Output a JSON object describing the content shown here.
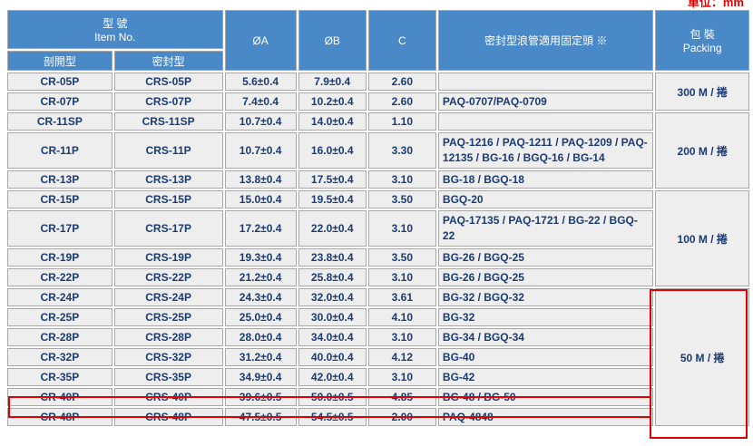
{
  "unit_label": "單位：mm",
  "header": {
    "item_no_zh": "型 號",
    "item_no_en": "Item No.",
    "col_a": "ØA",
    "col_b": "ØB",
    "col_c": "C",
    "fitting": "密封型浪管適用固定頭 ※",
    "packing_zh": "包 裝",
    "packing_en": "Packing",
    "split_type": "剖開型",
    "sealed_type": "密封型"
  },
  "rows": [
    {
      "split": "CR-05P",
      "sealed": "CRS-05P",
      "a": "5.6±0.4",
      "b": "7.9±0.4",
      "c": "2.60",
      "fitting": ""
    },
    {
      "split": "CR-07P",
      "sealed": "CRS-07P",
      "a": "7.4±0.4",
      "b": "10.2±0.4",
      "c": "2.60",
      "fitting": "PAQ-0707/PAQ-0709"
    },
    {
      "split": "CR-11SP",
      "sealed": "CRS-11SP",
      "a": "10.7±0.4",
      "b": "14.0±0.4",
      "c": "1.10",
      "fitting": ""
    },
    {
      "split": "CR-11P",
      "sealed": "CRS-11P",
      "a": "10.7±0.4",
      "b": "16.0±0.4",
      "c": "3.30",
      "fitting": "PAQ-1216 / PAQ-1211 / PAQ-1209 / PAQ-12135 / BG-16 / BGQ-16 / BG-14"
    },
    {
      "split": "CR-13P",
      "sealed": "CRS-13P",
      "a": "13.8±0.4",
      "b": "17.5±0.4",
      "c": "3.10",
      "fitting": "BG-18 / BGQ-18"
    },
    {
      "split": "CR-15P",
      "sealed": "CRS-15P",
      "a": "15.0±0.4",
      "b": "19.5±0.4",
      "c": "3.50",
      "fitting": "BGQ-20"
    },
    {
      "split": "CR-17P",
      "sealed": "CRS-17P",
      "a": "17.2±0.4",
      "b": "22.0±0.4",
      "c": "3.10",
      "fitting": "PAQ-17135 / PAQ-1721 / BG-22 / BGQ-22"
    },
    {
      "split": "CR-19P",
      "sealed": "CRS-19P",
      "a": "19.3±0.4",
      "b": "23.8±0.4",
      "c": "3.50",
      "fitting": "BG-26 / BGQ-25"
    },
    {
      "split": "CR-22P",
      "sealed": "CRS-22P",
      "a": "21.2±0.4",
      "b": "25.8±0.4",
      "c": "3.10",
      "fitting": "BG-26 / BGQ-25"
    },
    {
      "split": "CR-24P",
      "sealed": "CRS-24P",
      "a": "24.3±0.4",
      "b": "32.0±0.4",
      "c": "3.61",
      "fitting": "BG-32 / BGQ-32"
    },
    {
      "split": "CR-25P",
      "sealed": "CRS-25P",
      "a": "25.0±0.4",
      "b": "30.0±0.4",
      "c": "4.10",
      "fitting": "BG-32"
    },
    {
      "split": "CR-28P",
      "sealed": "CRS-28P",
      "a": "28.0±0.4",
      "b": "34.0±0.4",
      "c": "3.10",
      "fitting": "BG-34 / BGQ-34"
    },
    {
      "split": "CR-32P",
      "sealed": "CRS-32P",
      "a": "31.2±0.4",
      "b": "40.0±0.4",
      "c": "4.12",
      "fitting": "BG-40"
    },
    {
      "split": "CR-35P",
      "sealed": "CRS-35P",
      "a": "34.9±0.4",
      "b": "42.0±0.4",
      "c": "3.10",
      "fitting": "BG-42"
    },
    {
      "split": "CR-40P",
      "sealed": "CRS-40P",
      "a": "39.6±0.5",
      "b": "50.0±0.5",
      "c": "4.85",
      "fitting": "BG-48 / BG-50"
    },
    {
      "split": "CR-48P",
      "sealed": "CRS-48P",
      "a": "47.5±0.5",
      "b": "54.5±0.5",
      "c": "2.00",
      "fitting": "PAQ-4848"
    }
  ],
  "packing_groups": [
    {
      "label": "300 M / 捲"
    },
    {
      "label": "200 M / 捲"
    },
    {
      "label": "100 M / 捲"
    },
    {
      "label": "50 M / 捲"
    }
  ],
  "highlight_color": "#e00000",
  "header_color": "#4a89c7",
  "cell_color": "#eeeeee",
  "text_color": "#1a3b73"
}
